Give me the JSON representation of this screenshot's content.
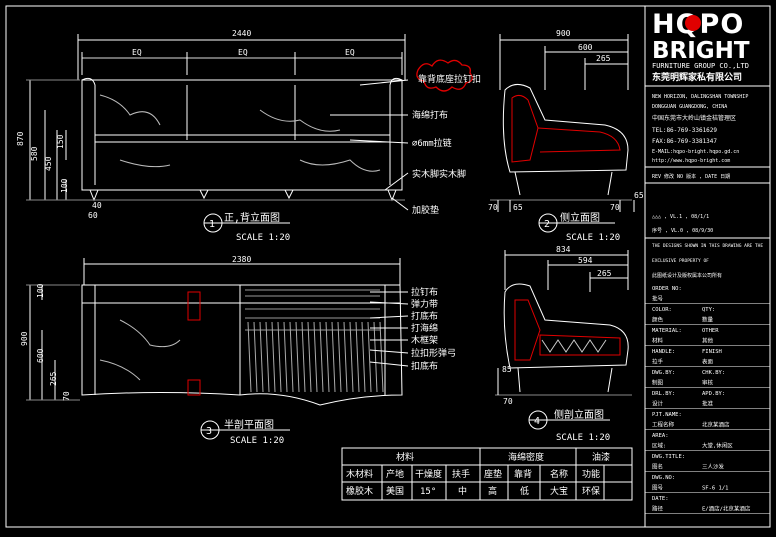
{
  "brand": {
    "logo_line1": "HQPO",
    "logo_line2": "BRIGHT",
    "company_en": "FURNITURE GROUP CO.,LTD",
    "company_cn": "东莞明辉家私有限公司",
    "address_lines": [
      "NEW HORIZON, DALINGSHAN TOWNSHIP",
      "DONGGUAN GUANGDONG, CHINA",
      "中国东莞市大岭山镇金桔管理区"
    ],
    "tel": "TEL:86-769-3361629",
    "fax": "FAX:86-769-3381347",
    "email": "E-MAIL:hqpo-bright.hqpo.gd.cn",
    "web": "http://www.hqpo-bright.com"
  },
  "revision": {
    "header": "REV 修改     NO 版本 ,  DATE 日期",
    "row1": "△△△      , VL.1  ,  08/1/1",
    "row2": "序号      , VL.0  ,  08/9/30"
  },
  "notes": [
    "THE DESIGNS SHOWN IN THIS DRAWING ARE THE",
    "EXCLUSIVE PROPERTY OF",
    "此图纸设计及版权属本公司所有"
  ],
  "spec": [
    {
      "label": "ORDER NO:",
      "value": ""
    },
    {
      "label": "批号",
      "value": ""
    },
    {
      "label": "COLOR:",
      "value": "QTY:"
    },
    {
      "label": "颜色",
      "value": "数量"
    },
    {
      "label": "MATERIAL:",
      "value": "OTHER"
    },
    {
      "label": "材料",
      "value": "其他"
    },
    {
      "label": "HANDLE:",
      "value": "FINISH"
    },
    {
      "label": "拉手",
      "value": "表面"
    },
    {
      "label": "DWG.BY:",
      "value": "CHK.BY:"
    },
    {
      "label": "制图",
      "value": "审核"
    },
    {
      "label": "DRL.BY:",
      "value": "APD.BY:"
    },
    {
      "label": "设计",
      "value": "批准"
    },
    {
      "label": "PJT.NAME:",
      "value": ""
    },
    {
      "label": "工程名称",
      "value": "北京某酒店"
    },
    {
      "label": "AREA:",
      "value": ""
    },
    {
      "label": "区域:",
      "value": "大堂,休闲区"
    },
    {
      "label": "DWG.TITLE:",
      "value": ""
    },
    {
      "label": "图名",
      "value": "三人沙发"
    },
    {
      "label": "DWG.NO:",
      "value": ""
    },
    {
      "label": "图号",
      "value": "SF-6   1/1"
    },
    {
      "label": "DATE:",
      "value": ""
    },
    {
      "label": "路径",
      "value": "E/酒店/北京某酒店"
    }
  ],
  "views": [
    {
      "num": "1",
      "title": "正,背立面图",
      "scale": "SCALE 1:20"
    },
    {
      "num": "2",
      "title": "侧立面图",
      "scale": "SCALE 1:20"
    },
    {
      "num": "3",
      "title": "半剖平面图",
      "scale": "SCALE 1:20"
    },
    {
      "num": "4",
      "title": "侧剖立面图",
      "scale": "SCALE 1:20"
    }
  ],
  "dims": {
    "front_width": "2440",
    "eq": "EQ",
    "front_heights": [
      "870",
      "580",
      "450",
      "150",
      "100"
    ],
    "leg_small": [
      "40",
      "60"
    ],
    "side_total": "900",
    "side_a": "600",
    "side_b": "265",
    "side_c": "70",
    "side_d": "65",
    "side_e": "70",
    "side_f": "65",
    "plan_width": "2380",
    "plan_heights": [
      "100",
      "900",
      "600",
      "265",
      "70"
    ],
    "sec_total": "834",
    "sec_a": "594",
    "sec_b": "265",
    "sec_c": "85",
    "sec_d": "70"
  },
  "callouts_front": [
    "靠背底座拉钉扣",
    "海绵打布",
    "∅6mm拉链",
    "实木脚实木脚",
    "加胶垫"
  ],
  "callouts_plan": [
    "拉钉布",
    "弹力带",
    "打底布",
    "打海绵",
    "木框架",
    "拉扣形弹弓",
    "扣底布"
  ],
  "table": {
    "headers": [
      "材料",
      "海绵密度",
      "油漆"
    ],
    "sub": [
      "木材料",
      "产地",
      "干燥度",
      "扶手",
      "座垫",
      "靠背",
      "名称",
      "功能"
    ],
    "row": [
      "橡胶木",
      "美国",
      "15°",
      "中",
      "高",
      "低",
      "大宝",
      "环保"
    ]
  }
}
